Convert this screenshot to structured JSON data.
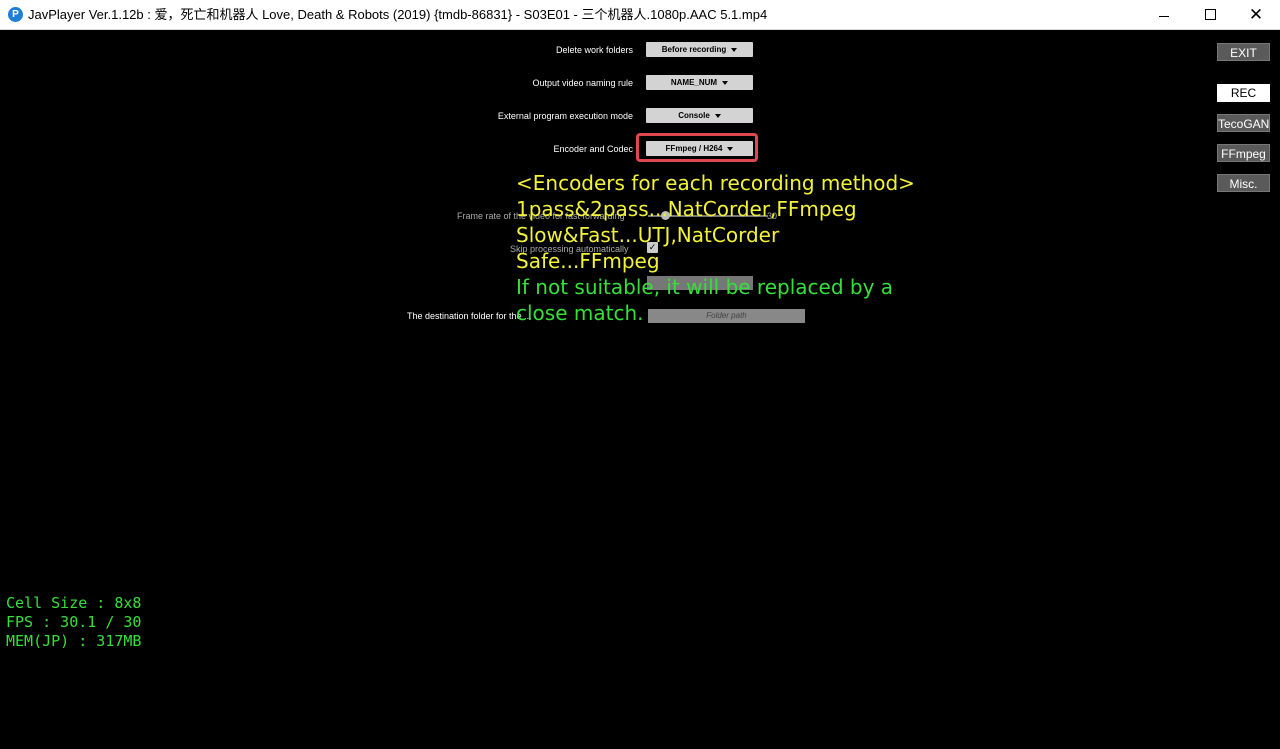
{
  "window": {
    "title": "JavPlayer Ver.1.12b : 爱，死亡和机器人 Love, Death & Robots (2019) {tmdb-86831} - S03E01 - 三个机器人.1080p.AAC 5.1.mp4",
    "minimize": "—",
    "close": "✕"
  },
  "settings": {
    "delete_work_folders": {
      "label": "Delete work folders",
      "value": "Before recording"
    },
    "output_naming": {
      "label": "Output video naming rule",
      "value": "NAME_NUM"
    },
    "external_exec": {
      "label": "External program execution mode",
      "value": "Console"
    },
    "encoder": {
      "label": "Encoder and Codec",
      "value": "FFmpeg / H264"
    },
    "frame_rate": {
      "label": "Frame rate of the video for fast forwarding",
      "value": "30"
    },
    "skip_processing": {
      "label": "Skip processing automatically"
    },
    "destination": {
      "label": "The destination folder for the ...",
      "placeholder": "Folder path"
    }
  },
  "overlay": {
    "yellow_lines": [
      "<Encoders for each recording method>",
      "1pass&2pass...NatCorder,FFmpeg",
      "Slow&Fast...UTJ,NatCorder",
      "Safe...FFmpeg"
    ],
    "green_lines": [
      "If not suitable, it will be replaced by a",
      "close match."
    ]
  },
  "sidebar": {
    "exit": "EXIT",
    "rec": "REC",
    "tecogan": "TecoGAN",
    "ffmpeg": "FFmpeg",
    "misc": "Misc."
  },
  "stats": {
    "cell_size": "Cell Size : 8x8",
    "fps": "FPS : 30.1 / 30",
    "mem": "MEM(JP) : 317MB"
  }
}
